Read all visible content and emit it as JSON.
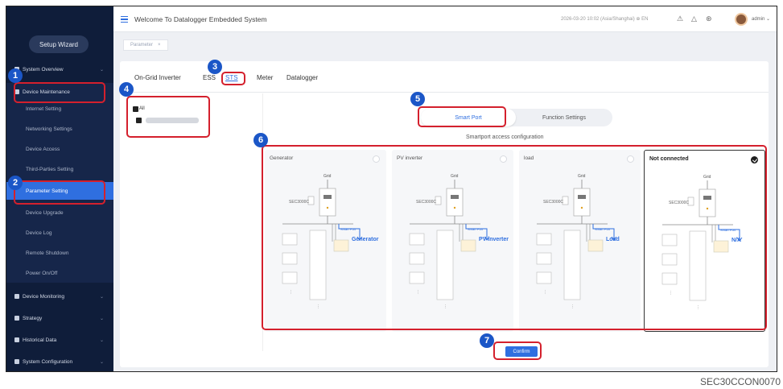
{
  "app": {
    "title": "Welcome To Datalogger Embedded System",
    "datetime": "2026-03-20 10:02 (Asia/Shanghai)",
    "language": "EN",
    "user": "admin"
  },
  "sidebar": {
    "wizard_label": "Setup Wizard",
    "sections": [
      {
        "label": "System Overview"
      },
      {
        "label": "Device Maintenance"
      },
      {
        "label": "Device Monitoring"
      },
      {
        "label": "Strategy"
      },
      {
        "label": "Historical Data"
      },
      {
        "label": "System Configuration"
      }
    ],
    "maintenance_items": [
      {
        "label": "Internet Setting"
      },
      {
        "label": "Networking Settings"
      },
      {
        "label": "Device Access"
      },
      {
        "label": "Third-Parties Setting"
      },
      {
        "label": "Parameter Setting"
      },
      {
        "label": "Device Upgrade"
      },
      {
        "label": "Device Log"
      },
      {
        "label": "Remote Shutdown"
      },
      {
        "label": "Power On/Off"
      }
    ]
  },
  "page_tab": {
    "label": "Parameter",
    "close": "×"
  },
  "device_tabs": [
    "On-Grid Inverter",
    "ESS",
    "STS",
    "Meter",
    "Datalogger"
  ],
  "device_list": {
    "all_label": "All"
  },
  "segment": {
    "smart_port": "Smart Port",
    "function_settings": "Function Settings"
  },
  "config_title": "Smartport access configuration",
  "cards": [
    {
      "title": "Generator",
      "dest": "Generator",
      "selected": false
    },
    {
      "title": "PV inverter",
      "dest": "PV inverter",
      "selected": false
    },
    {
      "title": "load",
      "dest": "Load",
      "selected": false
    },
    {
      "title": "Not connected",
      "dest": "N/A",
      "selected": true
    }
  ],
  "diagram": {
    "grid": "Grid",
    "sec": "SEC3000C",
    "port": "Smart Port"
  },
  "confirm_label": "Confirm",
  "callouts": [
    "1",
    "2",
    "3",
    "4",
    "5",
    "6",
    "7"
  ],
  "footer_code": "SEC30CCON0070",
  "colors": {
    "accent": "#2f6fe0",
    "sidebar": "#0f1d3a",
    "callout": "#d4202d",
    "badge": "#1b56c7"
  }
}
